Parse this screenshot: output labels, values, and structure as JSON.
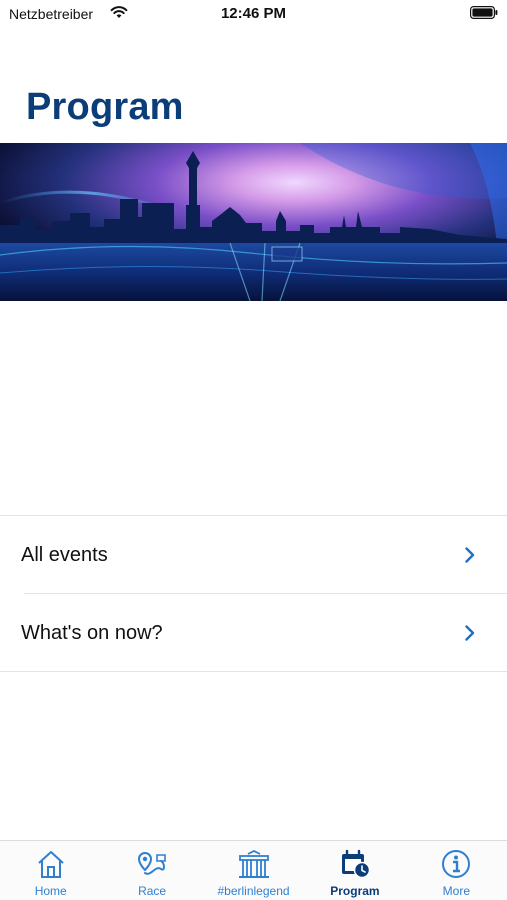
{
  "status_bar": {
    "carrier": "Netzbetreiber",
    "time": "12:46 PM",
    "icons": [
      "wifi-icon",
      "battery-icon"
    ]
  },
  "page": {
    "title": "Program"
  },
  "hero": {
    "icon": "berlin-skyline-image"
  },
  "menu": {
    "items": [
      {
        "label": "All events",
        "icon": "chevron-right-icon"
      },
      {
        "label": "What's on now?",
        "icon": "chevron-right-icon"
      }
    ]
  },
  "tab_bar": {
    "active": "Program",
    "tabs": [
      {
        "label": "Home",
        "icon": "home-icon"
      },
      {
        "label": "Race",
        "icon": "race-route-icon"
      },
      {
        "label": "#berlinlegend",
        "icon": "brandenburg-gate-icon"
      },
      {
        "label": "Program",
        "icon": "calendar-clock-icon"
      },
      {
        "label": "More",
        "icon": "info-icon"
      }
    ]
  },
  "colors": {
    "title": "#0b3d78",
    "accent": "#2f7fd1",
    "chevron": "#1f6fc4",
    "divider": "#e3e3e3"
  }
}
